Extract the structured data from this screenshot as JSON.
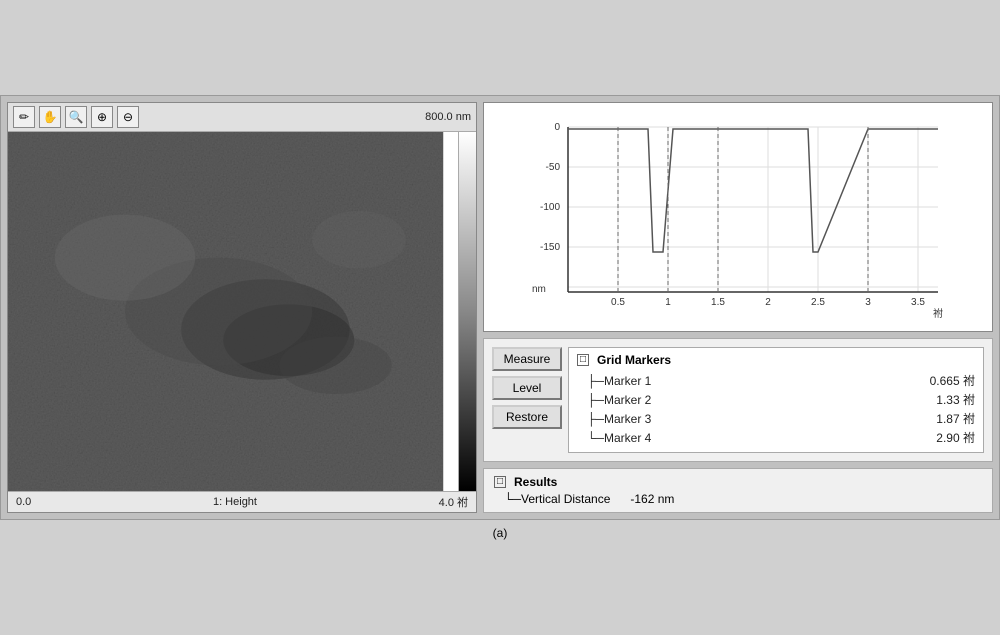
{
  "toolbar": {
    "tools": [
      {
        "name": "pointer-tool",
        "icon": "✏",
        "label": "Pointer"
      },
      {
        "name": "hand-tool",
        "icon": "✋",
        "label": "Hand"
      },
      {
        "name": "zoom-tool",
        "icon": "🔍",
        "label": "Zoom"
      },
      {
        "name": "zoom-in-tool",
        "icon": "⊕",
        "label": "Zoom In"
      },
      {
        "name": "zoom-out-tool",
        "icon": "⊖",
        "label": "Zoom Out"
      }
    ],
    "scale_label": "800.0 nm"
  },
  "image_footer": {
    "left": "0.0",
    "center": "1: Height",
    "right": "4.0 祔"
  },
  "graph": {
    "x_axis": {
      "labels": [
        "0.5",
        "1",
        "1.5",
        "2",
        "2.5",
        "3",
        "3.5"
      ],
      "unit": "祔"
    },
    "y_axis": {
      "labels": [
        "0",
        "-50",
        "-100",
        "-150"
      ],
      "unit": "nm"
    }
  },
  "buttons": {
    "measure": "Measure",
    "level": "Level",
    "restore": "Restore"
  },
  "grid_markers": {
    "title": "Grid Markers",
    "expand_symbol": "□",
    "markers": [
      {
        "label": "Marker 1",
        "value": "0.665 祔"
      },
      {
        "label": "Marker 2",
        "value": "1.33 祔"
      },
      {
        "label": "Marker 3",
        "value": "1.87 祔"
      },
      {
        "label": "Marker 4",
        "value": "2.90 祔"
      }
    ]
  },
  "results": {
    "title": "Results",
    "expand_symbol": "□",
    "items": [
      {
        "label": "Vertical Distance",
        "value": "-162 nm"
      }
    ]
  },
  "caption": "(a)"
}
